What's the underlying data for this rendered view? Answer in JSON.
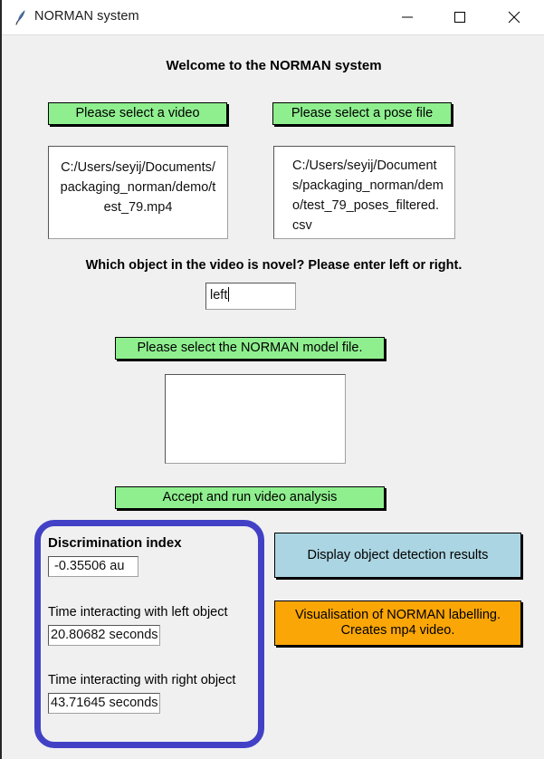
{
  "window": {
    "title": "NORMAN system",
    "icon": "feather-icon",
    "background_color": "#f0f0f0",
    "controls": {
      "minimize": "minimize-icon",
      "maximize": "maximize-icon",
      "close": "close-icon"
    }
  },
  "main": {
    "welcome_heading": "Welcome to the NORMAN system",
    "select_video_button": "Please select a video",
    "select_pose_button": "Please select a pose file",
    "video_path": "C:/Users/seyij/Documents/packaging_norman/demo/test_79.mp4",
    "pose_path": "C:/Users/seyij/Documents/packaging_norman/demo/test_79_poses_filtered.csv",
    "novel_question": "Which object in the video is novel? Please enter left or right.",
    "novel_answer": "left",
    "novel_placeholder": "",
    "select_model_button": "Please select the NORMAN model file.",
    "model_path": "",
    "accept_button": "Accept and run video analysis"
  },
  "results": {
    "discrimination_index_label": "Discrimination index",
    "discrimination_index_value": " -0.35506 au",
    "left_object_label": "Time interacting with left object",
    "left_object_value": "20.80682 seconds",
    "right_object_label": "Time interacting with right object",
    "right_object_value": "43.71645 seconds",
    "panel_border_color": "#4241c6"
  },
  "actions": {
    "display_detection_button": "Display object detection results",
    "visualisation_button_line1": "Visualisation of NORMAN labelling.",
    "visualisation_button_line2": "Creates mp4 video."
  },
  "colors": {
    "green_button": "#8fef8f",
    "blue_button": "#abd5e2",
    "orange_button": "#fba607"
  }
}
